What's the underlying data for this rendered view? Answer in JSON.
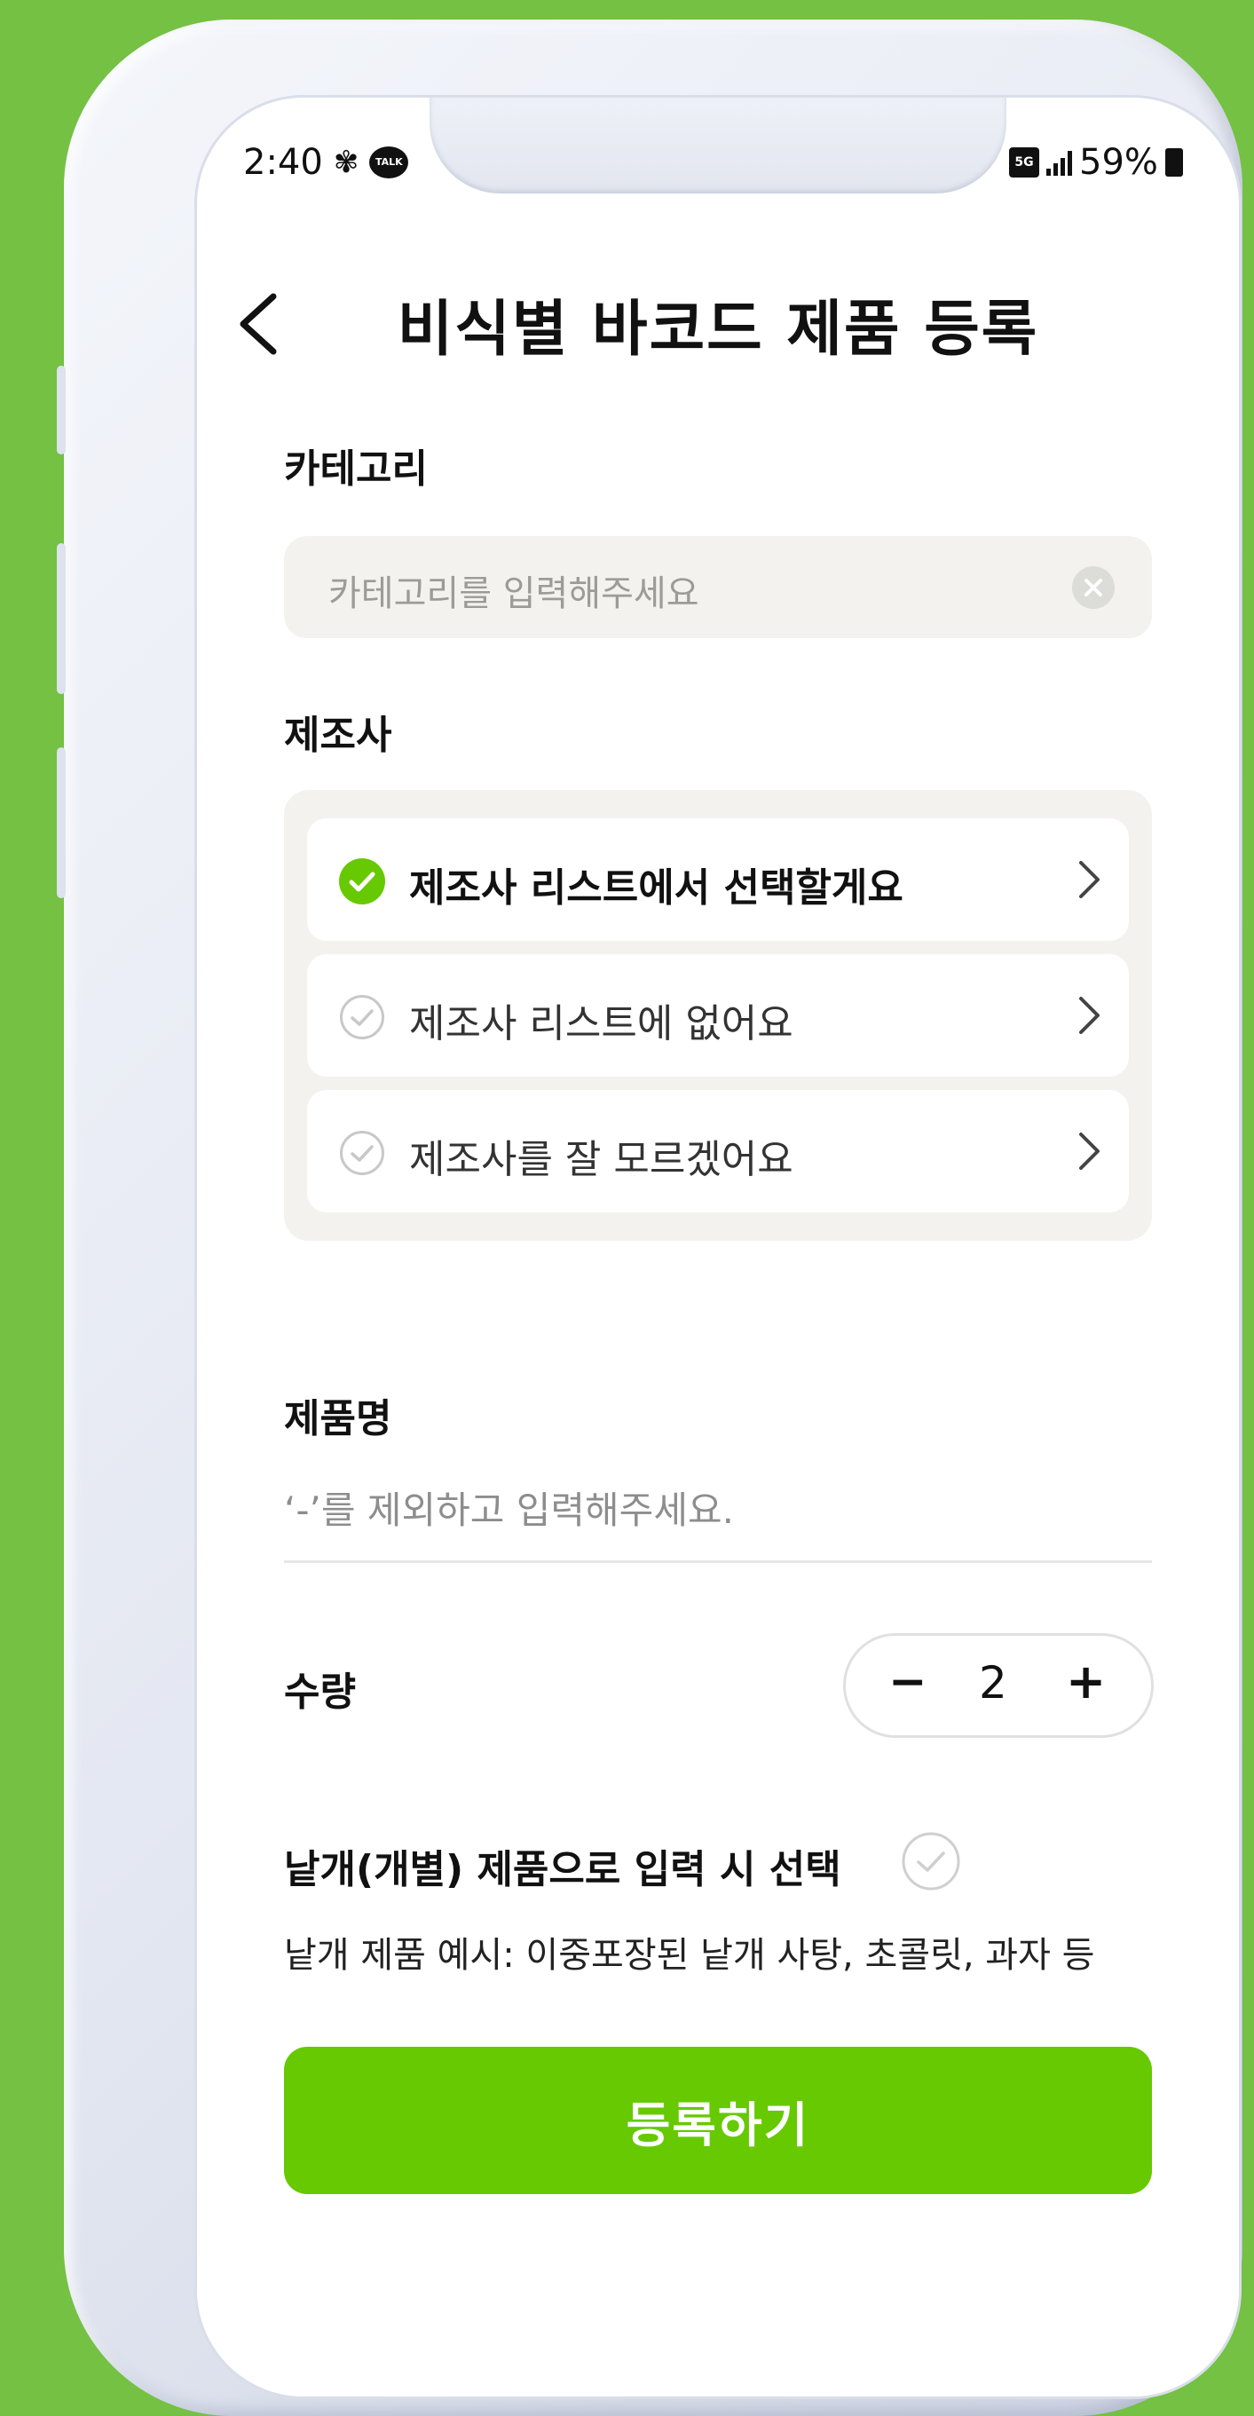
{
  "status_bar": {
    "time": "2:40",
    "network": "5G",
    "battery": "59%"
  },
  "header": {
    "title": "비식별 바코드 제품 등록"
  },
  "category": {
    "label": "카테고리",
    "placeholder": "카테고리를 입력해주세요"
  },
  "manufacturer": {
    "label": "제조사",
    "options": [
      {
        "label": "제조사 리스트에서 선택할게요",
        "selected": true
      },
      {
        "label": "제조사 리스트에 없어요",
        "selected": false
      },
      {
        "label": "제조사를 잘 모르겠어요",
        "selected": false
      }
    ]
  },
  "product_name": {
    "label": "제품명",
    "placeholder": "‘-’를 제외하고 입력해주세요."
  },
  "quantity": {
    "label": "수량",
    "value": "2",
    "minus": "−",
    "plus": "+"
  },
  "single_item": {
    "label": "낱개(개별) 제품으로 입력 시 선택",
    "example": "낱개 제품 예시: 이중포장된 낱개 사탕, 초콜릿, 과자 등"
  },
  "submit": {
    "label": "등록하기"
  },
  "colors": {
    "accent": "#66c902",
    "background": "#74c143",
    "panel": "#f3f2ee"
  }
}
